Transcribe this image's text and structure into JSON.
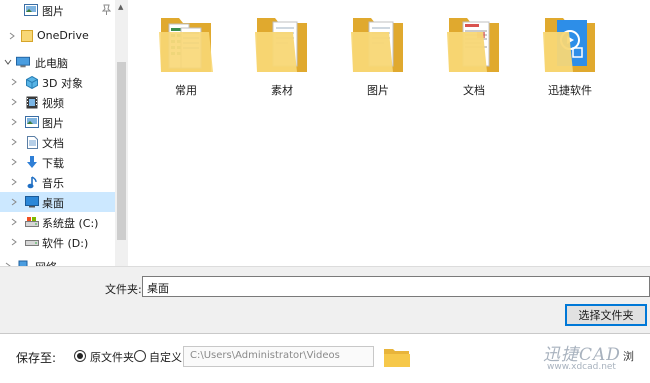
{
  "sidebar": {
    "items": [
      {
        "label": "图片",
        "icon": "pictures-folder-icon",
        "pinned": true
      },
      {
        "label": "OneDrive",
        "icon": "onedrive-folder-icon"
      },
      {
        "label": "此电脑",
        "icon": "this-pc-icon",
        "expanded": true
      },
      {
        "label": "3D 对象",
        "icon": "3d-objects-icon"
      },
      {
        "label": "视频",
        "icon": "videos-icon"
      },
      {
        "label": "图片",
        "icon": "pictures-icon"
      },
      {
        "label": "文档",
        "icon": "documents-icon"
      },
      {
        "label": "下载",
        "icon": "downloads-icon"
      },
      {
        "label": "音乐",
        "icon": "music-icon"
      },
      {
        "label": "桌面",
        "icon": "desktop-icon",
        "selected": true
      },
      {
        "label": "系统盘 (C:)",
        "icon": "drive-c-icon"
      },
      {
        "label": "软件 (D:)",
        "icon": "drive-d-icon"
      },
      {
        "label": "网络",
        "icon": "network-icon"
      }
    ]
  },
  "files": [
    {
      "name": "常用",
      "icon": "folder-spreadsheet-icon"
    },
    {
      "name": "素材",
      "icon": "folder-documents-icon"
    },
    {
      "name": "图片",
      "icon": "folder-documents-icon"
    },
    {
      "name": "文档",
      "icon": "folder-pages-icon"
    },
    {
      "name": "迅捷软件",
      "icon": "folder-app-icon"
    }
  ],
  "dialog": {
    "folder_label": "文件夹:",
    "folder_value": "桌面",
    "select_button": "选择文件夹"
  },
  "save": {
    "label": "保存至:",
    "option_original": "原文件夹",
    "option_custom": "自定义",
    "path": "C:\\Users\\Administrator\\Videos",
    "selected_option": "原文件夹"
  },
  "watermark": {
    "main": "迅捷CAD",
    "url": "www.xdcad.net",
    "tail": "浏"
  },
  "colors": {
    "selection": "#cce8ff",
    "accent": "#0078d7",
    "folder": "#f5c64e"
  }
}
